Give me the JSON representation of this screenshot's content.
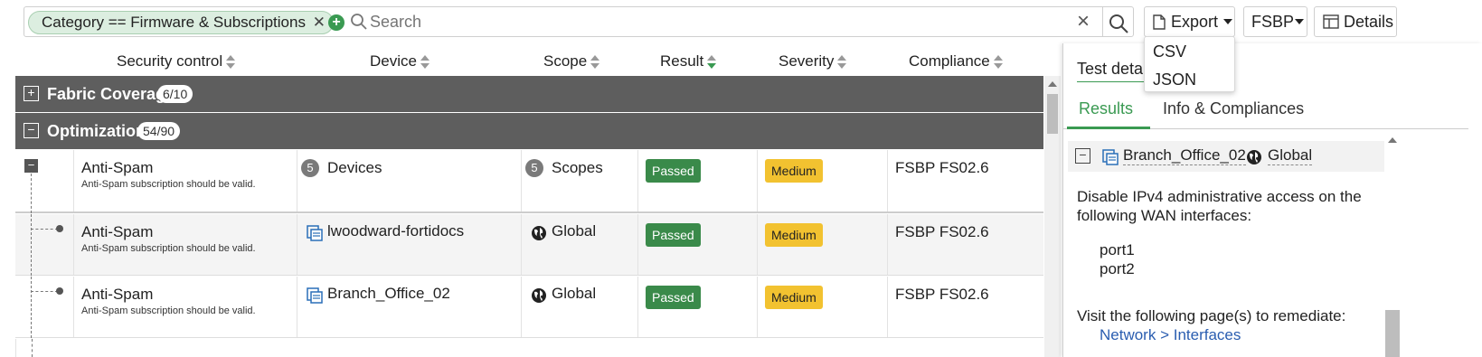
{
  "toolbar": {
    "filter_chip": "Category == Firmware & Subscriptions",
    "search_placeholder": "Search",
    "export_label": "Export",
    "framework_label": "FSBP",
    "details_label": "Details"
  },
  "export_menu": {
    "items": [
      "CSV",
      "JSON"
    ]
  },
  "columns": [
    "Security control",
    "Device",
    "Scope",
    "Result",
    "Severity",
    "Compliance"
  ],
  "groups": [
    {
      "name": "Fabric Coverage",
      "count": "6/10",
      "expanded": false
    },
    {
      "name": "Optimization",
      "count": "54/90",
      "expanded": true
    }
  ],
  "rows": [
    {
      "control": "Anti-Spam",
      "desc": "Anti-Spam subscription should be valid.",
      "device_count": "5",
      "device": "Devices",
      "scope_count": "5",
      "scope": "Scopes",
      "result": "Passed",
      "severity": "Medium",
      "compliance": "FSBP FS02.6"
    },
    {
      "control": "Anti-Spam",
      "desc": "Anti-Spam subscription should be valid.",
      "device": "lwoodward-fortidocs",
      "scope": "Global",
      "result": "Passed",
      "severity": "Medium",
      "compliance": "FSBP FS02.6"
    },
    {
      "control": "Anti-Spam",
      "desc": "Anti-Spam subscription should be valid.",
      "device": "Branch_Office_02",
      "scope": "Global",
      "result": "Passed",
      "severity": "Medium",
      "compliance": "FSBP FS02.6"
    }
  ],
  "details": {
    "title": "Test details",
    "tabs": [
      "Results",
      "Info & Compliances"
    ],
    "device": "Branch_Office_02",
    "scope": "Global",
    "description_line1": "Disable IPv4 administrative access on the",
    "description_line2": "following WAN interfaces:",
    "ports": [
      "port1",
      "port2"
    ],
    "remediate_text": "Visit the following page(s) to remediate:",
    "remediate_link": "Network > Interfaces"
  },
  "colors": {
    "accent": "#3a9a52",
    "group_bg": "#5e5e5e",
    "passed": "#3a8a4a",
    "medium": "#f2c230"
  }
}
